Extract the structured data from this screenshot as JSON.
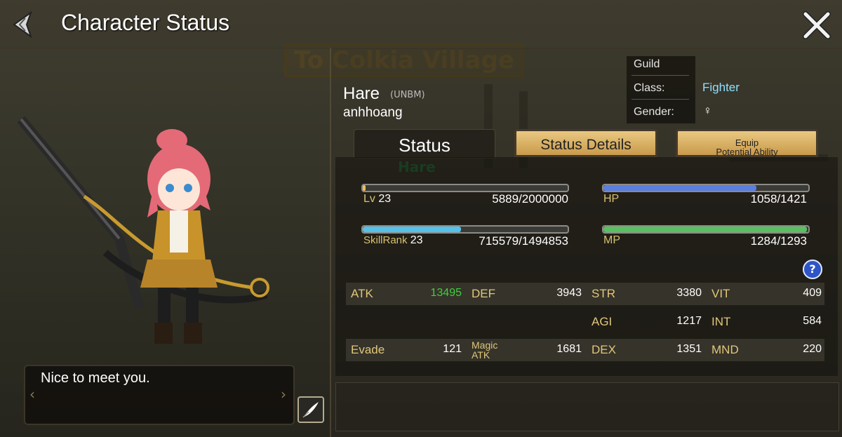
{
  "header": {
    "title": "Character Status"
  },
  "background": {
    "sign_text": "To Colkia Village",
    "ghost_name": "Hare"
  },
  "character": {
    "name": "Hare",
    "tag": "(UNBM)",
    "username": "anhhoang",
    "greeting": "Nice to meet you."
  },
  "info": {
    "guild_label": "Guild",
    "class_label": "Class:",
    "class_value": "Fighter",
    "gender_label": "Gender:",
    "gender_value": "♀"
  },
  "tabs": [
    {
      "label": "Status"
    },
    {
      "label": "Status Details"
    },
    {
      "label": "Equip",
      "sublabel": "Potential Ability"
    }
  ],
  "bars": {
    "level": {
      "label": "Lv",
      "level": "23",
      "value": "5889/2000000",
      "fraction": 0.003,
      "color": "#f0c050"
    },
    "hp": {
      "label": "HP",
      "value": "1058/1421",
      "fraction": 0.745,
      "color": "#5b7fe0"
    },
    "skill": {
      "label": "SkillRank",
      "level": "23",
      "value": "715579/1494853",
      "fraction": 0.479,
      "color": "#55c0e8"
    },
    "mp": {
      "label": "MP",
      "value": "1284/1293",
      "fraction": 0.993,
      "color": "#58c060"
    }
  },
  "stats": {
    "atk": {
      "label": "ATK",
      "value": "13495",
      "color": "#3ecf3e"
    },
    "def": {
      "label": "DEF",
      "value": "3943"
    },
    "str": {
      "label": "STR",
      "value": "3380"
    },
    "vit": {
      "label": "VIT",
      "value": "409"
    },
    "agi": {
      "label": "AGI",
      "value": "1217"
    },
    "int": {
      "label": "INT",
      "value": "584"
    },
    "evade": {
      "label": "Evade",
      "value": "121"
    },
    "matk": {
      "label_line1": "Magic",
      "label_line2": "ATK",
      "value": "1681"
    },
    "dex": {
      "label": "DEX",
      "value": "1351"
    },
    "mnd": {
      "label": "MND",
      "value": "220"
    }
  },
  "help_label": "?"
}
